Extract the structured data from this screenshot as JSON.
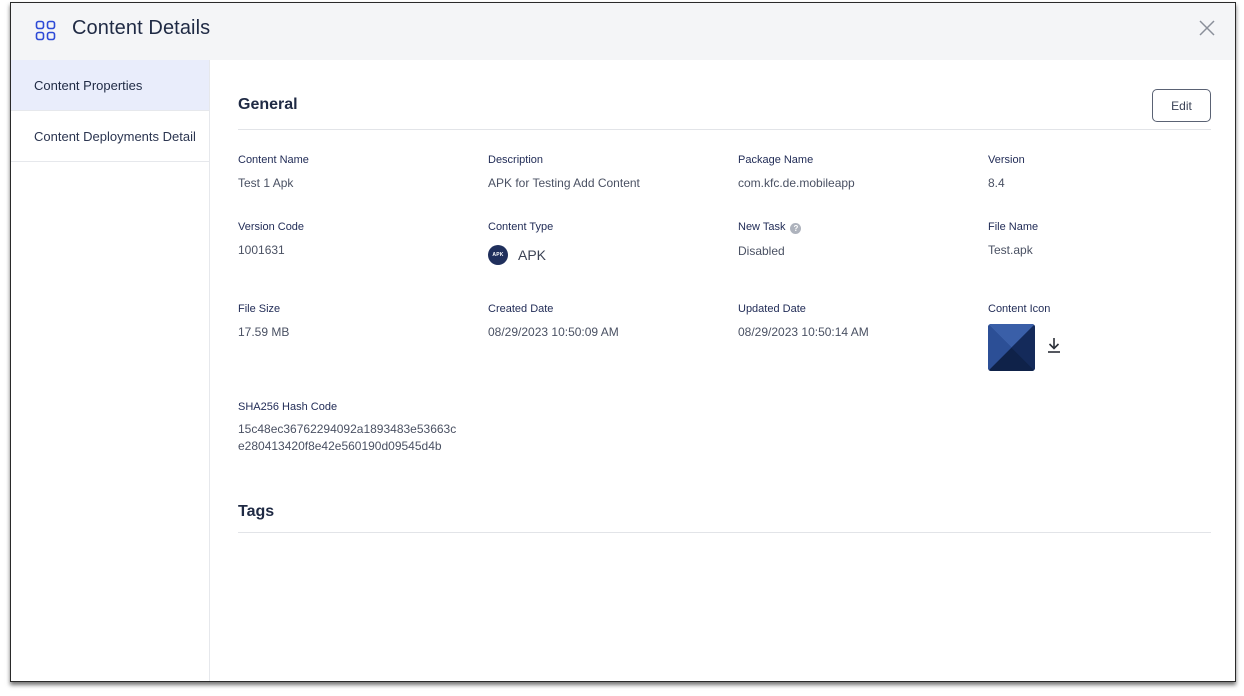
{
  "header": {
    "title": "Content Details"
  },
  "sidebar": {
    "items": [
      {
        "label": "Content Properties",
        "active": true
      },
      {
        "label": "Content Deployments Detail",
        "active": false
      }
    ]
  },
  "general": {
    "title": "General",
    "edit_label": "Edit",
    "fields": {
      "content_name": {
        "label": "Content Name",
        "value": "Test 1 Apk"
      },
      "description": {
        "label": "Description",
        "value": "APK for Testing Add Content"
      },
      "package_name": {
        "label": "Package Name",
        "value": "com.kfc.de.mobileapp"
      },
      "version": {
        "label": "Version",
        "value": "8.4"
      },
      "version_code": {
        "label": "Version Code",
        "value": "1001631"
      },
      "content_type": {
        "label": "Content Type",
        "value": "APK",
        "badge": "APK"
      },
      "new_task": {
        "label": "New Task",
        "value": "Disabled",
        "help_icon": "?"
      },
      "file_name": {
        "label": "File Name",
        "value": "Test.apk"
      },
      "file_size": {
        "label": "File Size",
        "value": "17.59 MB"
      },
      "created_date": {
        "label": "Created Date",
        "value": "08/29/2023 10:50:09 AM"
      },
      "updated_date": {
        "label": "Updated Date",
        "value": "08/29/2023 10:50:14 AM"
      },
      "content_icon": {
        "label": "Content Icon"
      },
      "sha256": {
        "label": "SHA256 Hash Code",
        "line1": "15c48ec36762294092a1893483e53663c",
        "line2": "e280413420f8e42e560190d09545d4b"
      }
    }
  },
  "tags": {
    "title": "Tags"
  },
  "colors": {
    "header_bg": "#f4f5f7",
    "sidebar_active_bg": "#e9edfb",
    "text_primary": "#1f2a44",
    "badge_bg": "#1f2f5c"
  },
  "icons": {
    "header": "grid-icon",
    "close": "close-icon",
    "help": "help-icon",
    "download": "download-icon"
  }
}
